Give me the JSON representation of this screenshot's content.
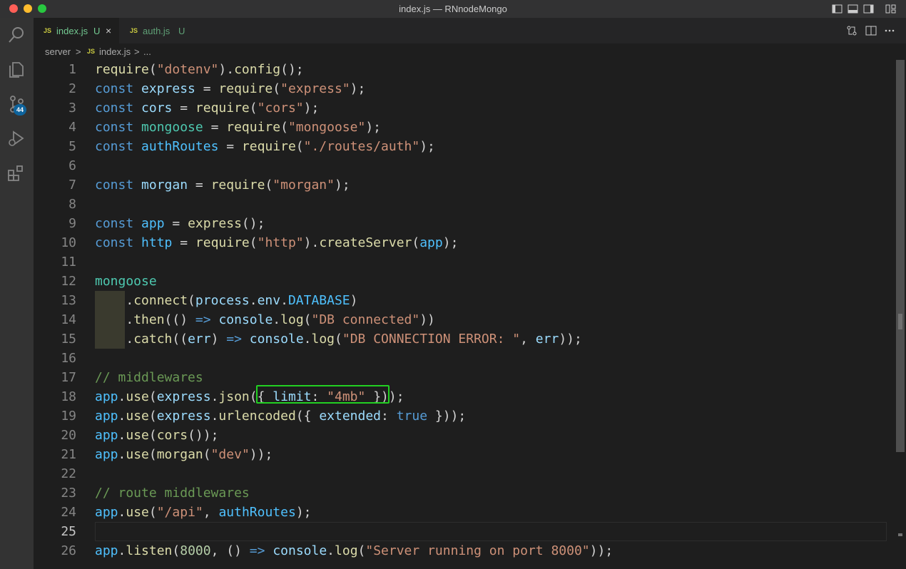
{
  "window": {
    "title": "index.js — RNnodeMongo"
  },
  "activity_bar": {
    "scm_badge": "44"
  },
  "tabs": [
    {
      "js": "JS",
      "name": "index.js",
      "status": "U",
      "close": "×"
    },
    {
      "js": "JS",
      "name": "auth.js",
      "status": "U"
    }
  ],
  "breadcrumb": {
    "folder": "server",
    "sep1": ">",
    "js": "JS",
    "file": "index.js",
    "sep2": ">",
    "ellipsis": "..."
  },
  "editor": {
    "current_line": 25,
    "lines": [
      [
        [
          "f",
          "require"
        ],
        [
          "p",
          "("
        ],
        [
          "s",
          "\"dotenv\""
        ],
        [
          "p",
          ")."
        ],
        [
          "f",
          "config"
        ],
        [
          "p",
          "();"
        ]
      ],
      [
        [
          "k",
          "const"
        ],
        [
          "p",
          " "
        ],
        [
          "v",
          "express"
        ],
        [
          "p",
          " = "
        ],
        [
          "f",
          "require"
        ],
        [
          "p",
          "("
        ],
        [
          "s",
          "\"express\""
        ],
        [
          "p",
          ");"
        ]
      ],
      [
        [
          "k",
          "const"
        ],
        [
          "p",
          " "
        ],
        [
          "v",
          "cors"
        ],
        [
          "p",
          " = "
        ],
        [
          "f",
          "require"
        ],
        [
          "p",
          "("
        ],
        [
          "s",
          "\"cors\""
        ],
        [
          "p",
          ");"
        ]
      ],
      [
        [
          "k",
          "const"
        ],
        [
          "p",
          " "
        ],
        [
          "t",
          "mongoose"
        ],
        [
          "p",
          " = "
        ],
        [
          "f",
          "require"
        ],
        [
          "p",
          "("
        ],
        [
          "s",
          "\"mongoose\""
        ],
        [
          "p",
          ");"
        ]
      ],
      [
        [
          "k",
          "const"
        ],
        [
          "p",
          " "
        ],
        [
          "cn",
          "authRoutes"
        ],
        [
          "p",
          " = "
        ],
        [
          "f",
          "require"
        ],
        [
          "p",
          "("
        ],
        [
          "s",
          "\"./routes/auth\""
        ],
        [
          "p",
          ");"
        ]
      ],
      [],
      [
        [
          "k",
          "const"
        ],
        [
          "p",
          " "
        ],
        [
          "v",
          "morgan"
        ],
        [
          "p",
          " = "
        ],
        [
          "f",
          "require"
        ],
        [
          "p",
          "("
        ],
        [
          "s",
          "\"morgan\""
        ],
        [
          "p",
          ");"
        ]
      ],
      [],
      [
        [
          "k",
          "const"
        ],
        [
          "p",
          " "
        ],
        [
          "cn",
          "app"
        ],
        [
          "p",
          " = "
        ],
        [
          "f",
          "express"
        ],
        [
          "p",
          "();"
        ]
      ],
      [
        [
          "k",
          "const"
        ],
        [
          "p",
          " "
        ],
        [
          "cn",
          "http"
        ],
        [
          "p",
          " = "
        ],
        [
          "f",
          "require"
        ],
        [
          "p",
          "("
        ],
        [
          "s",
          "\"http\""
        ],
        [
          "p",
          ")."
        ],
        [
          "f",
          "createServer"
        ],
        [
          "p",
          "("
        ],
        [
          "cn",
          "app"
        ],
        [
          "p",
          ");"
        ]
      ],
      [],
      [
        [
          "t",
          "mongoose"
        ]
      ],
      [
        [
          "p",
          "    ."
        ],
        [
          "f",
          "connect"
        ],
        [
          "p",
          "("
        ],
        [
          "v",
          "process"
        ],
        [
          "p",
          "."
        ],
        [
          "v",
          "env"
        ],
        [
          "p",
          "."
        ],
        [
          "cn",
          "DATABASE"
        ],
        [
          "p",
          ")"
        ]
      ],
      [
        [
          "p",
          "    ."
        ],
        [
          "f",
          "then"
        ],
        [
          "p",
          "(() "
        ],
        [
          "k",
          "=>"
        ],
        [
          "p",
          " "
        ],
        [
          "v",
          "console"
        ],
        [
          "p",
          "."
        ],
        [
          "f",
          "log"
        ],
        [
          "p",
          "("
        ],
        [
          "s",
          "\"DB connected\""
        ],
        [
          "p",
          "))"
        ]
      ],
      [
        [
          "p",
          "    ."
        ],
        [
          "f",
          "catch"
        ],
        [
          "p",
          "(("
        ],
        [
          "v",
          "err"
        ],
        [
          "p",
          ") "
        ],
        [
          "k",
          "=>"
        ],
        [
          "p",
          " "
        ],
        [
          "v",
          "console"
        ],
        [
          "p",
          "."
        ],
        [
          "f",
          "log"
        ],
        [
          "p",
          "("
        ],
        [
          "s",
          "\"DB CONNECTION ERROR: \""
        ],
        [
          "p",
          ", "
        ],
        [
          "v",
          "err"
        ],
        [
          "p",
          "));"
        ]
      ],
      [],
      [
        [
          "c",
          "// middlewares"
        ]
      ],
      [
        [
          "cn",
          "app"
        ],
        [
          "p",
          "."
        ],
        [
          "f",
          "use"
        ],
        [
          "p",
          "("
        ],
        [
          "v",
          "express"
        ],
        [
          "p",
          "."
        ],
        [
          "f",
          "json"
        ],
        [
          "p",
          "({ "
        ],
        [
          "v",
          "limit"
        ],
        [
          "p",
          ": "
        ],
        [
          "s",
          "\"4mb\""
        ],
        [
          "p",
          " }));"
        ]
      ],
      [
        [
          "cn",
          "app"
        ],
        [
          "p",
          "."
        ],
        [
          "f",
          "use"
        ],
        [
          "p",
          "("
        ],
        [
          "v",
          "express"
        ],
        [
          "p",
          "."
        ],
        [
          "f",
          "urlencoded"
        ],
        [
          "p",
          "({ "
        ],
        [
          "v",
          "extended"
        ],
        [
          "p",
          ": "
        ],
        [
          "k",
          "true"
        ],
        [
          "p",
          " }));"
        ]
      ],
      [
        [
          "cn",
          "app"
        ],
        [
          "p",
          "."
        ],
        [
          "f",
          "use"
        ],
        [
          "p",
          "("
        ],
        [
          "f",
          "cors"
        ],
        [
          "p",
          "());"
        ]
      ],
      [
        [
          "cn",
          "app"
        ],
        [
          "p",
          "."
        ],
        [
          "f",
          "use"
        ],
        [
          "p",
          "("
        ],
        [
          "f",
          "morgan"
        ],
        [
          "p",
          "("
        ],
        [
          "s",
          "\"dev\""
        ],
        [
          "p",
          "));"
        ]
      ],
      [],
      [
        [
          "c",
          "// route middlewares"
        ]
      ],
      [
        [
          "cn",
          "app"
        ],
        [
          "p",
          "."
        ],
        [
          "f",
          "use"
        ],
        [
          "p",
          "("
        ],
        [
          "s",
          "\"/api\""
        ],
        [
          "p",
          ", "
        ],
        [
          "cn",
          "authRoutes"
        ],
        [
          "p",
          ");"
        ]
      ],
      [],
      [
        [
          "cn",
          "app"
        ],
        [
          "p",
          "."
        ],
        [
          "f",
          "listen"
        ],
        [
          "p",
          "("
        ],
        [
          "n",
          "8000"
        ],
        [
          "p",
          ", () "
        ],
        [
          "k",
          "=>"
        ],
        [
          "p",
          " "
        ],
        [
          "v",
          "console"
        ],
        [
          "p",
          "."
        ],
        [
          "f",
          "log"
        ],
        [
          "p",
          "("
        ],
        [
          "s",
          "\"Server running on port 8000\""
        ],
        [
          "p",
          "));"
        ]
      ]
    ]
  },
  "colors": {
    "accent": "#0e639c",
    "highlight_box": "#22d022",
    "modified": "#73c991"
  }
}
